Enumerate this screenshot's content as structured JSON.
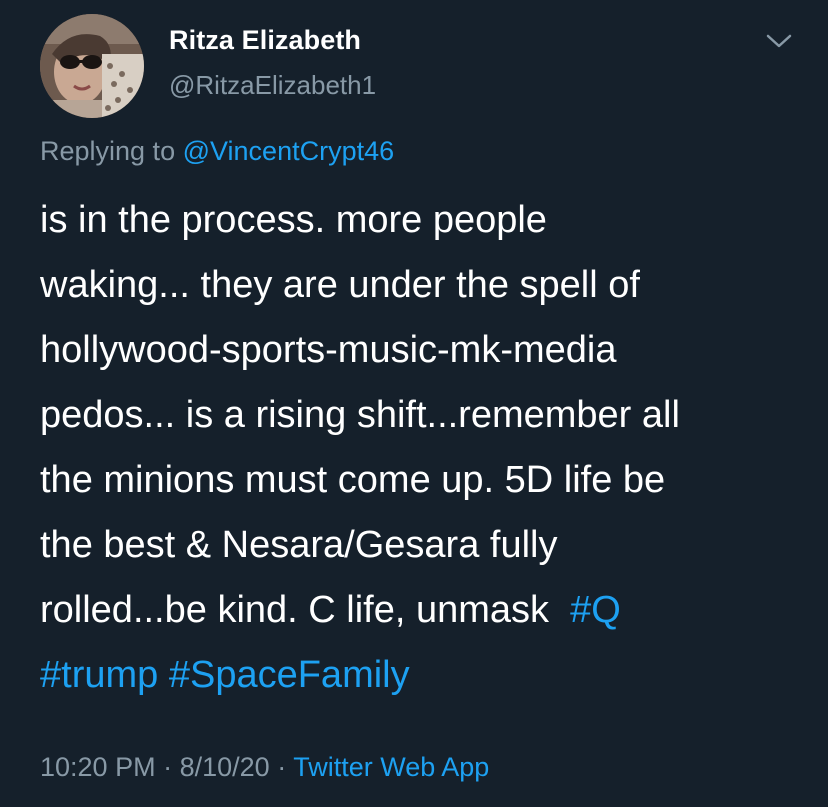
{
  "tweet": {
    "author": {
      "display_name": "Ritza Elizabeth",
      "handle": "@RitzaElizabeth1"
    },
    "reply": {
      "prefix": "Replying to",
      "mention": "@VincentCrypt46"
    },
    "body_lines": [
      "is in the process. more people",
      "waking... they are under the spell of",
      "hollywood-sports-music-mk-media",
      "pedos... is a rising shift...remember all",
      "the minions must come up. 5D life be",
      "the best & Nesara/Gesara fully",
      "rolled...be kind. C life, unmask"
    ],
    "hashtags": {
      "q": "#Q",
      "trump": "#trump",
      "spacefamily": "#SpaceFamily"
    },
    "meta": {
      "time": "10:20 PM",
      "separator": "·",
      "date": "8/10/20",
      "source": "Twitter Web App"
    }
  },
  "colors": {
    "background": "#15202b",
    "text_primary": "#ffffff",
    "text_secondary": "#8899a6",
    "accent": "#1da1f2"
  },
  "icons": {
    "menu": "chevron-down-icon"
  }
}
